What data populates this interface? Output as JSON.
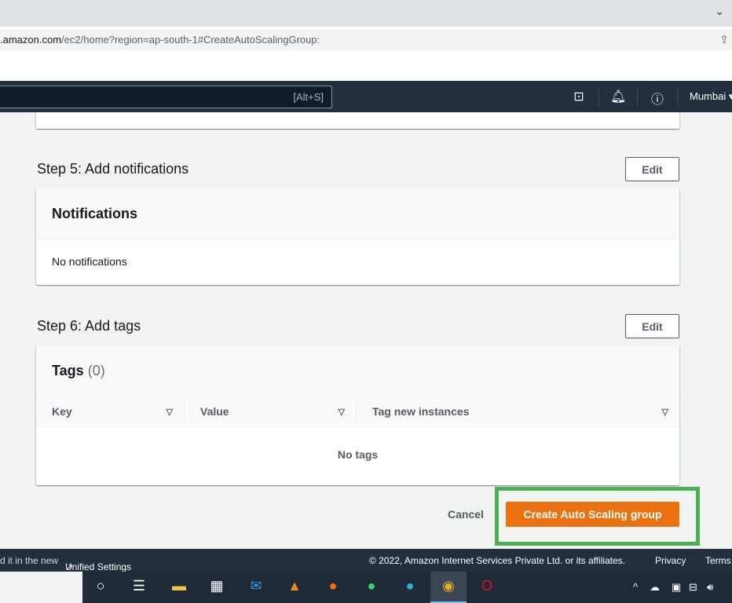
{
  "browser": {
    "url_host": ".amazon.com",
    "url_path": "/ec2/home?region=ap-south-1#CreateAutoScalingGroup:"
  },
  "aws_nav": {
    "search_shortcut": "[Alt+S]",
    "region": "Mumbai ▾",
    "icons": [
      "cloudshell-icon",
      "bell-icon",
      "help-icon"
    ]
  },
  "step5": {
    "title": "Step 5: Add notifications",
    "edit": "Edit",
    "panel_title": "Notifications",
    "body": "No notifications"
  },
  "step6": {
    "title": "Step 6: Add tags",
    "edit": "Edit",
    "panel_title": "Tags",
    "count": "(0)",
    "columns": [
      "Key",
      "Value",
      "Tag new instances"
    ],
    "empty": "No tags"
  },
  "actions": {
    "cancel": "Cancel",
    "create": "Create Auto Scaling group",
    "highlight_color": "#4caf50",
    "primary_color": "#ec7211"
  },
  "footer": {
    "settings_prefix": "d it in the new",
    "settings_link": "Unified Settings",
    "copyright": "© 2022, Amazon Internet Services Private Ltd. or its affiliates.",
    "privacy": "Privacy",
    "terms": "Terms"
  },
  "taskbar": {
    "apps": [
      "cortana",
      "task-view",
      "file-explorer",
      "microsoft-store",
      "mail",
      "vlc",
      "firefox",
      "whatsapp",
      "edge",
      "chrome",
      "opera"
    ]
  }
}
